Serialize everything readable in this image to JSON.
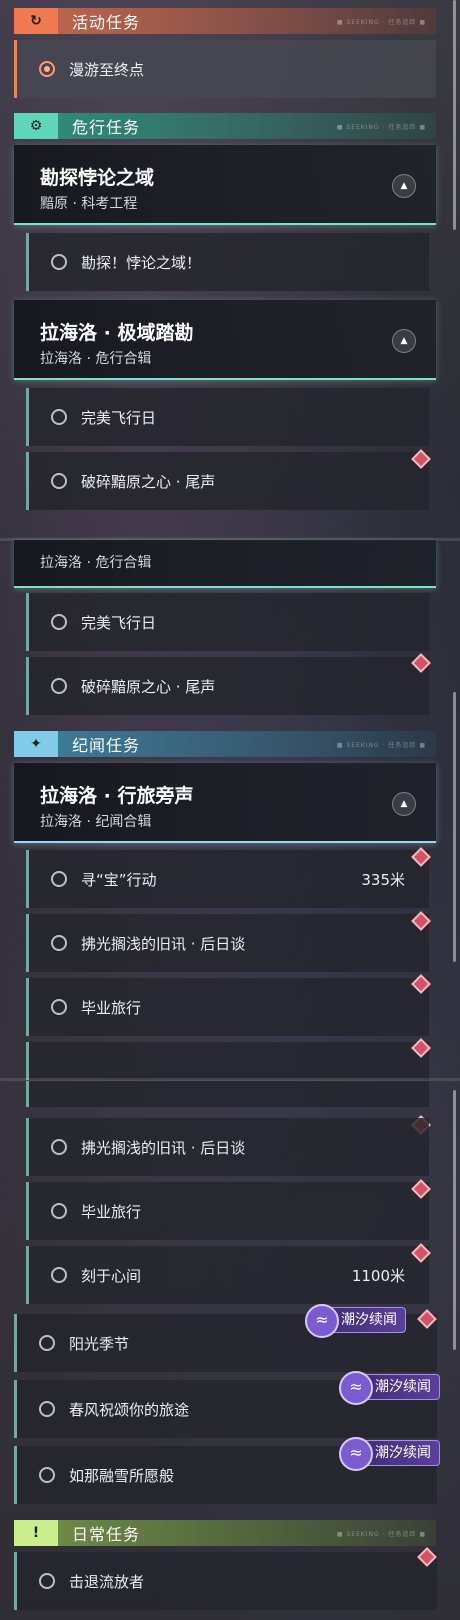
{
  "tide_label": "潮汐续闻",
  "header_deco": "■ SEEKING · 任务追踪 ■",
  "categories": {
    "activity": "活动任务",
    "danger": "危行任务",
    "chronicle": "纪闻任务",
    "daily": "日常任务"
  },
  "tasks": {
    "roam": "漫游至终点",
    "explore": "勘探！悖论之域！",
    "flight": "完美飞行日",
    "heart": "破碎黯原之心 · 尾声",
    "seek": "寻“宝”行动",
    "seek_dist": "335米",
    "news": "拂光搁浅的旧讯 · 后日谈",
    "grad": "毕业旅行",
    "heart_carve": "刻于心间",
    "heart_carve_dist": "1100米",
    "sun": "阳光季节",
    "spring": "春风祝颂你的旅途",
    "snow": "如那融雪所愿般",
    "repel": "击退流放者"
  },
  "groups": {
    "paradox": {
      "title": "勘探悖论之域",
      "sub": "黯原 · 科考工程"
    },
    "lahailuo_danger": {
      "title": "拉海洛 · 极域踏勘",
      "sub": "拉海洛 · 危行合辑"
    },
    "lahailuo_journey": {
      "title": "拉海洛 · 行旅旁声",
      "sub": "拉海洛 · 纪闻合辑"
    }
  },
  "colors": {
    "activity_accent": "#f07b52",
    "danger_accent": "#5fd6b7",
    "chronicle_accent": "#7fcbe8",
    "daily_accent": "#c9ee8a",
    "marker": "#d25462",
    "tide_badge": "#5b3f9e"
  }
}
